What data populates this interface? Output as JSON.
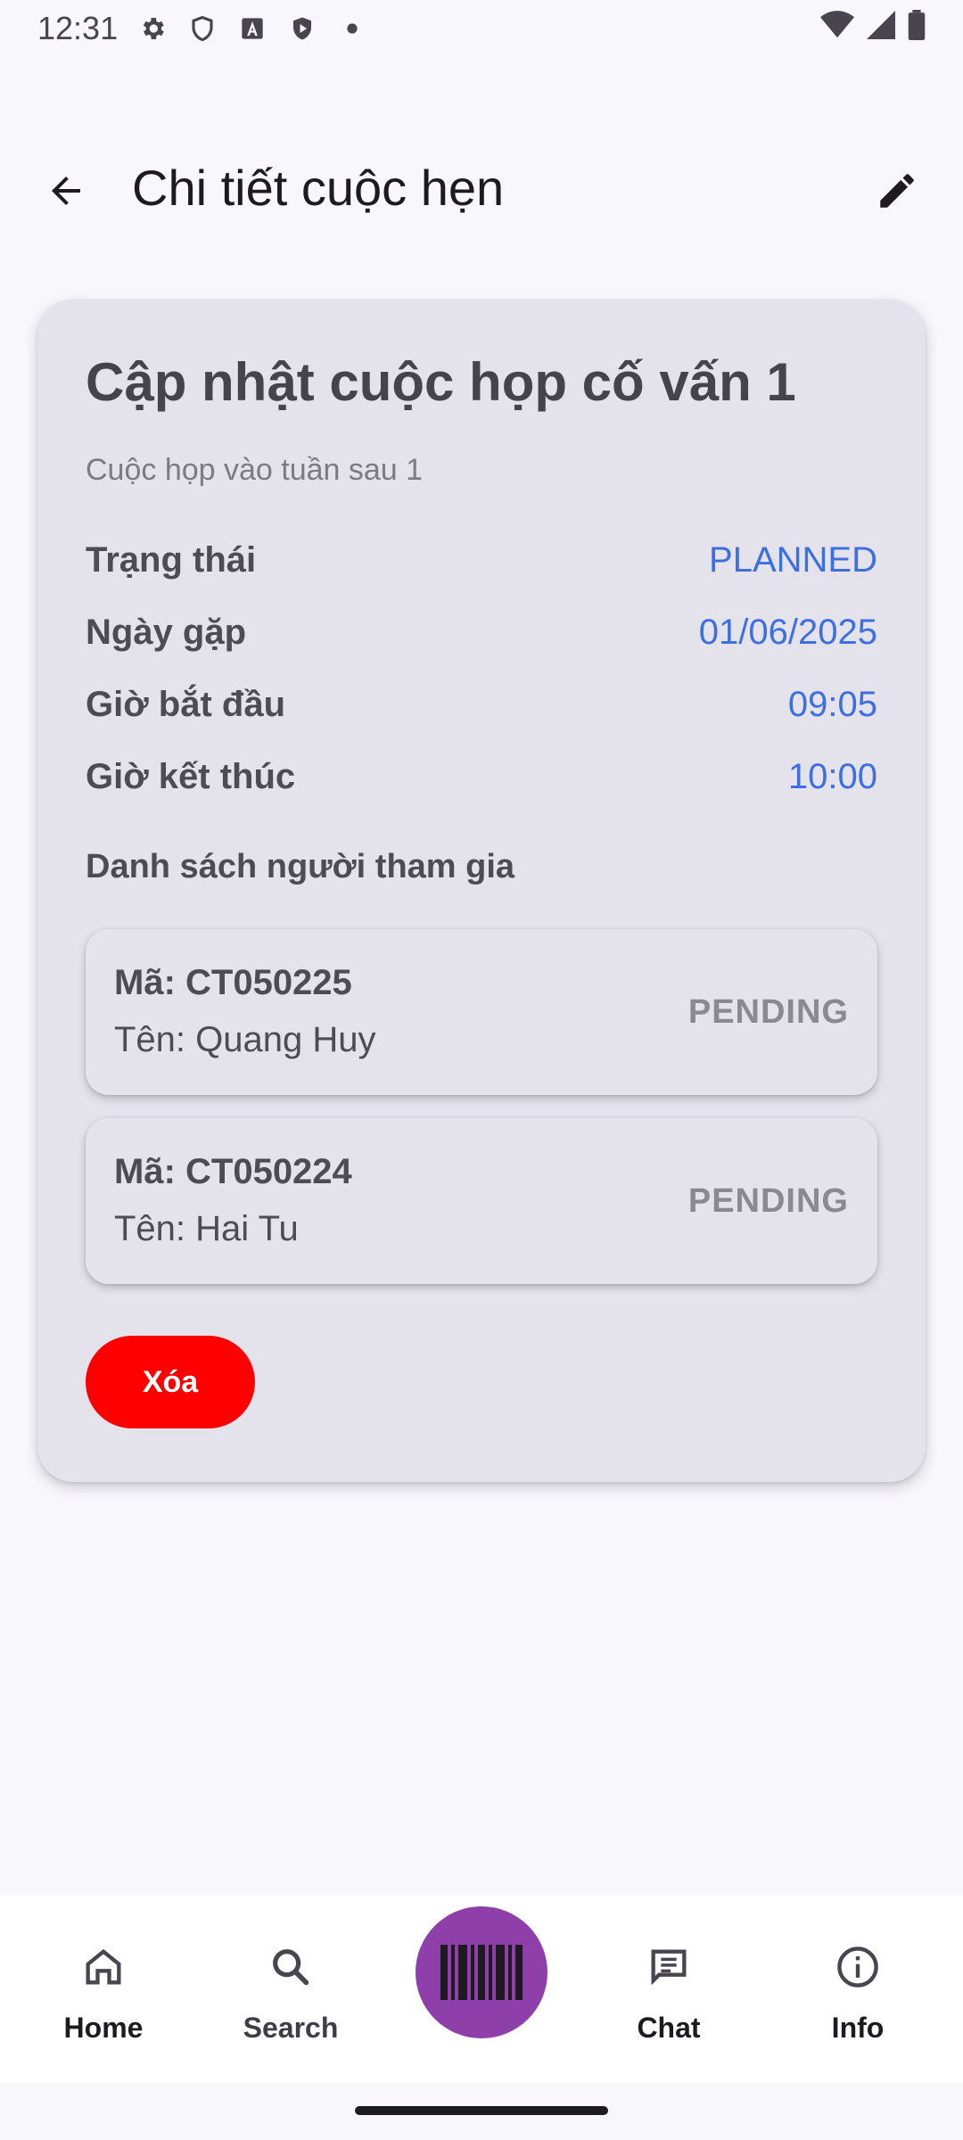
{
  "status_bar": {
    "time": "12:31",
    "icons": [
      "gear-icon",
      "shield-icon",
      "font-a-icon",
      "play-protect-icon",
      "dot-icon"
    ],
    "right_icons": [
      "wifi-icon",
      "signal-icon",
      "battery-icon"
    ]
  },
  "app_bar": {
    "title": "Chi tiết cuộc hẹn",
    "back_icon": "arrow-back-icon",
    "edit_icon": "pencil-icon"
  },
  "appointment": {
    "title": "Cập nhật cuộc họp cố vấn 1",
    "subtitle": "Cuộc họp vào tuần sau 1",
    "status_label": "Trạng thái",
    "status_value": "PLANNED",
    "date_label": "Ngày gặp",
    "date_value": "01/06/2025",
    "start_label": "Giờ bắt đầu",
    "start_value": "09:05",
    "end_label": "Giờ kết thúc",
    "end_value": "10:00",
    "value_color": "#3e6fe0"
  },
  "participants": {
    "section_title": "Danh sách người tham gia",
    "items": [
      {
        "code": "Mã: CT050225",
        "name": "Tên: Quang Huy",
        "status": "PENDING"
      },
      {
        "code": "Mã: CT050224",
        "name": "Tên: Hai Tu",
        "status": "PENDING"
      }
    ]
  },
  "actions": {
    "delete_label": "Xóa",
    "delete_color": "#ff0000"
  },
  "bottom_nav": {
    "items": [
      {
        "label": "Home",
        "icon": "home-icon"
      },
      {
        "label": "Search",
        "icon": "search-icon"
      },
      {
        "label": "Chat",
        "icon": "chat-icon"
      },
      {
        "label": "Info",
        "icon": "info-icon"
      }
    ],
    "fab_icon": "barcode-icon",
    "fab_color": "#8f3fa9"
  }
}
